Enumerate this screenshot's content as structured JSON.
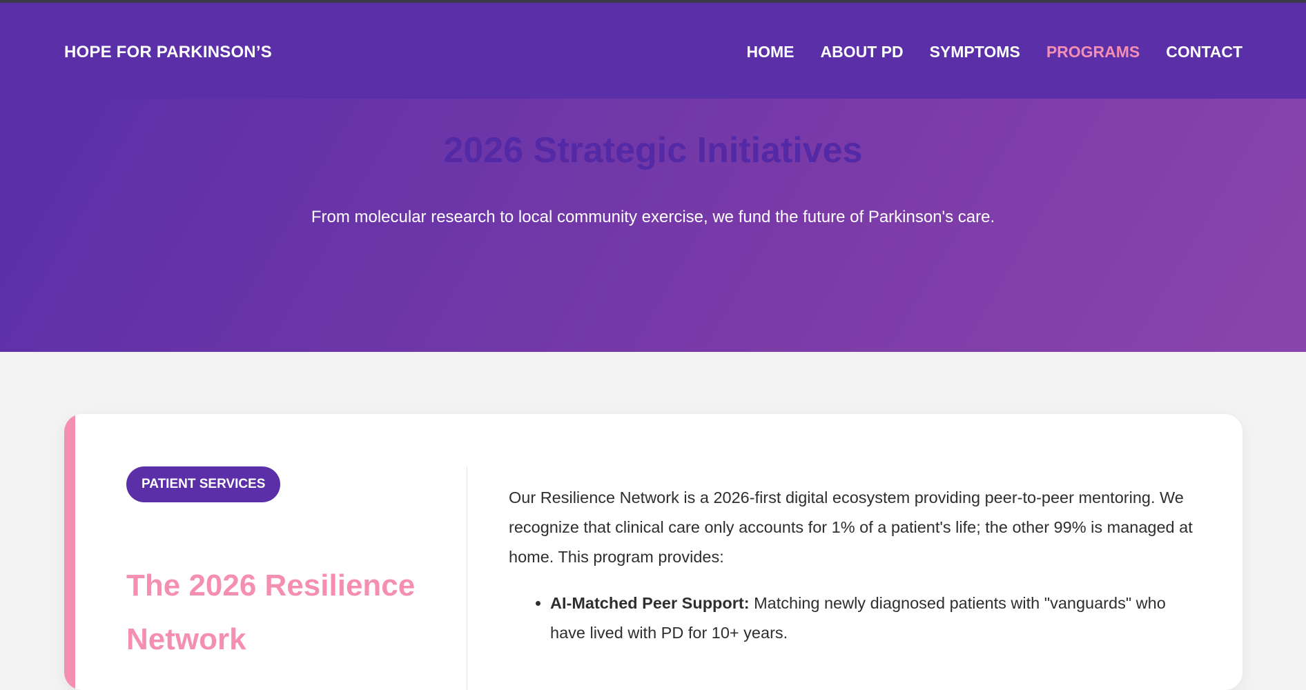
{
  "nav": {
    "brand": "HOPE FOR PARKINSON’S",
    "links": [
      "HOME",
      "ABOUT PD",
      "SYMPTOMS",
      "PROGRAMS",
      "CONTACT"
    ],
    "active": "PROGRAMS"
  },
  "hero": {
    "title": "2026 Strategic Initiatives",
    "subtitle": "From molecular research to local community exercise, we fund the future of Parkinson's care."
  },
  "card": {
    "badge": "PATIENT SERVICES",
    "title": "The 2026 Resilience Network",
    "description": "Our Resilience Network is a 2026-first digital ecosystem providing peer-to-peer mentoring. We recognize that clinical care only accounts for 1% of a patient's life; the other 99% is managed at home. This program provides:",
    "items": [
      {
        "label": "AI-Matched Peer Support:",
        "text": " Matching newly diagnosed patients with \"vanguards\" who have lived with PD for 10+ years."
      }
    ]
  },
  "colors": {
    "nav_bg": "#5a2fa8",
    "accent_pink": "#f48fb1",
    "hero_gradient_end": "#8a44ad",
    "page_bg": "#f3f3f3"
  }
}
